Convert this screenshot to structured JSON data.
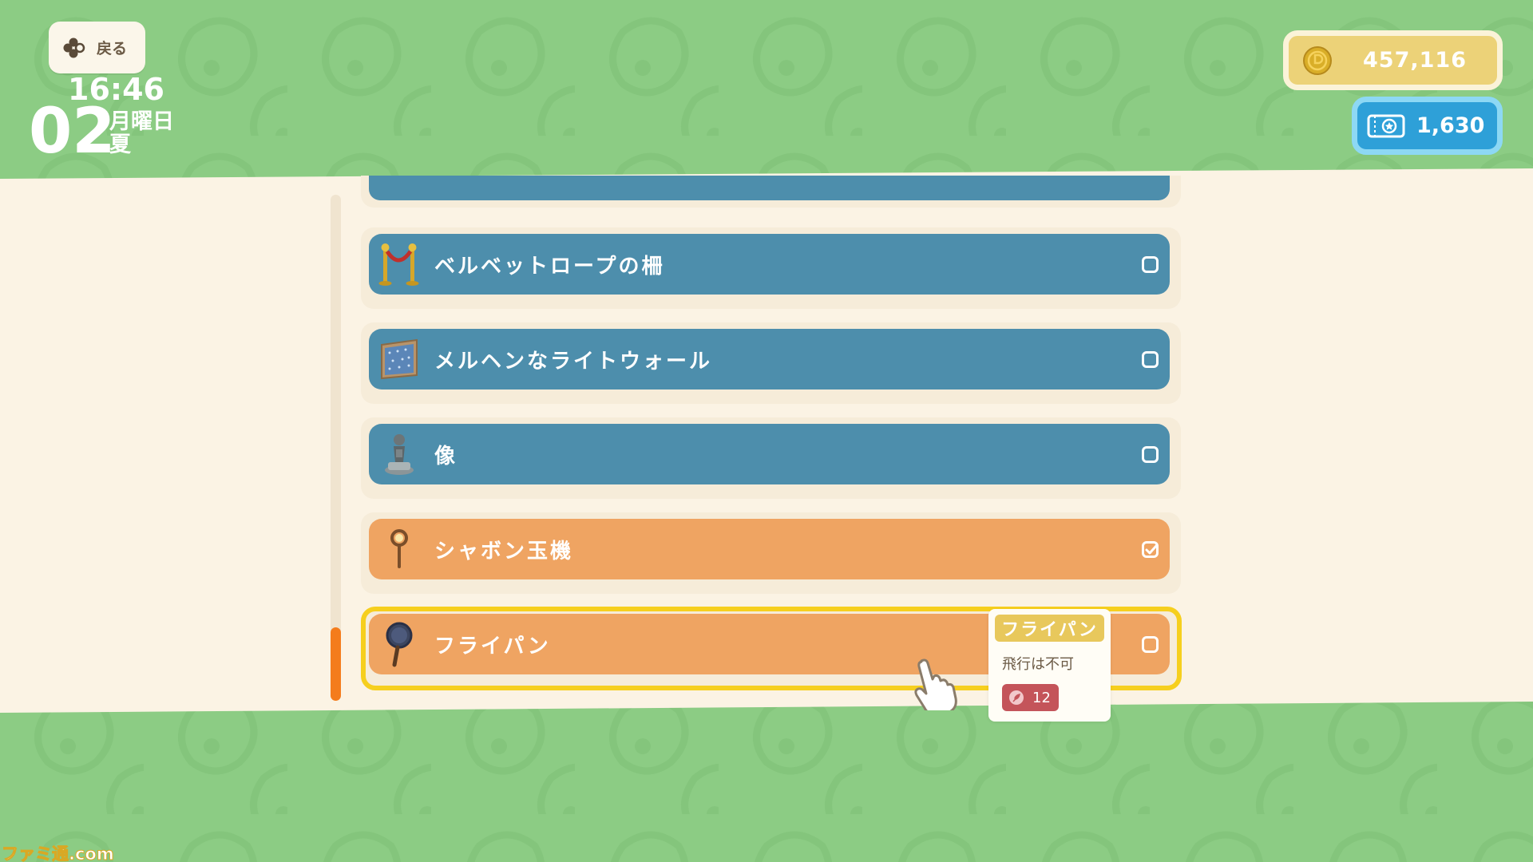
{
  "header": {
    "back_label": "戻る",
    "time": "16:46",
    "day": "02",
    "weekday": "月曜日",
    "season": "夏"
  },
  "currency": {
    "bells": "457,116",
    "miles": "1,630",
    "bells_icon": "coin-icon",
    "miles_icon": "ticket-icon"
  },
  "list": {
    "items": [
      {
        "label": "ベルベットロープの柵",
        "color": "blue",
        "checked": false,
        "icon": "velvet-rope-icon"
      },
      {
        "label": "メルヘンなライトウォール",
        "color": "blue",
        "checked": false,
        "icon": "light-wall-icon"
      },
      {
        "label": "像",
        "color": "blue",
        "checked": false,
        "icon": "statue-icon"
      },
      {
        "label": "シャボン玉機",
        "color": "orange",
        "checked": true,
        "icon": "bubble-machine-icon"
      },
      {
        "label": "フライパン",
        "color": "orange",
        "checked": false,
        "icon": "frying-pan-icon",
        "selected": true
      }
    ]
  },
  "tooltip": {
    "title": "フライパン",
    "description": "飛行は不可",
    "count": "12",
    "icon": "feather-icon"
  },
  "watermark": "ファミ通.com",
  "colors": {
    "background_green": "#8ccc84",
    "panel_cream": "#fbf3e4",
    "bar_blue": "#4d8eac",
    "bar_orange": "#efa462",
    "select_yellow": "#f6cf1e",
    "scroll_orange": "#f47c1c",
    "miles_blue": "#2ea0d8",
    "bells_gold": "#ecd278"
  }
}
